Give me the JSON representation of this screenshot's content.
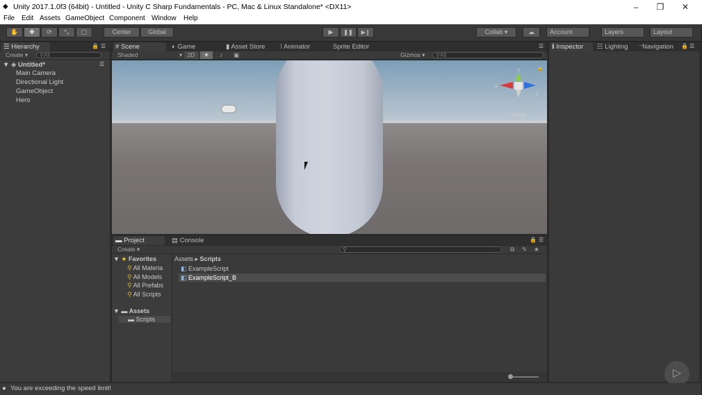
{
  "window": {
    "title": "Unity 2017.1.0f3 (64bit) - Untitled - Unity C Sharp Fundamentals - PC, Mac & Linux Standalone* <DX11>",
    "minimize": "–",
    "maximize": "❐",
    "close": "✕"
  },
  "menu": [
    "File",
    "Edit",
    "Assets",
    "GameObject",
    "Component",
    "Window",
    "Help"
  ],
  "toolbar": {
    "hand": "✋",
    "move": "✥",
    "rotate": "⟳",
    "scale": "⤡",
    "rect": "▢",
    "center": "Center",
    "global": "Global",
    "play": "▶",
    "pause": "❚❚",
    "step": "▶❙",
    "collab": "Collab ▾",
    "cloud": "☁",
    "account": "Account",
    "layers": "Layers",
    "layout": "Layout"
  },
  "hierarchy": {
    "tab": "Hierarchy",
    "create": "Create ▾",
    "search": "All",
    "scene": "Untitled*",
    "items": [
      "Main Camera",
      "Directional Light",
      "GameObject",
      "Hero"
    ]
  },
  "scene_tabs": [
    "Scene",
    "Game",
    "Asset Store",
    "Animator",
    "Sprite Editor"
  ],
  "scene_bar": {
    "shading": "Shaded",
    "mode2d": "2D",
    "gizmos": "Gizmos ▾",
    "search": "All",
    "persp": "Persp",
    "axes": {
      "y": "y",
      "x": "x",
      "z": "z"
    }
  },
  "inspector_tabs": [
    "Inspector",
    "Lighting",
    "Navigation"
  ],
  "project": {
    "tabs": [
      "Project",
      "Console"
    ],
    "create": "Create ▾",
    "favorites": "Favorites",
    "fav_items": [
      "All Materia",
      "All Models",
      "All Prefabs",
      "All Scripts"
    ],
    "assets": "Assets",
    "scripts": "Scripts",
    "path": [
      "Assets",
      "Scripts"
    ],
    "files": [
      "ExampleScript",
      "ExampleScript_B"
    ]
  },
  "status": "You are exceeding the speed limit!"
}
